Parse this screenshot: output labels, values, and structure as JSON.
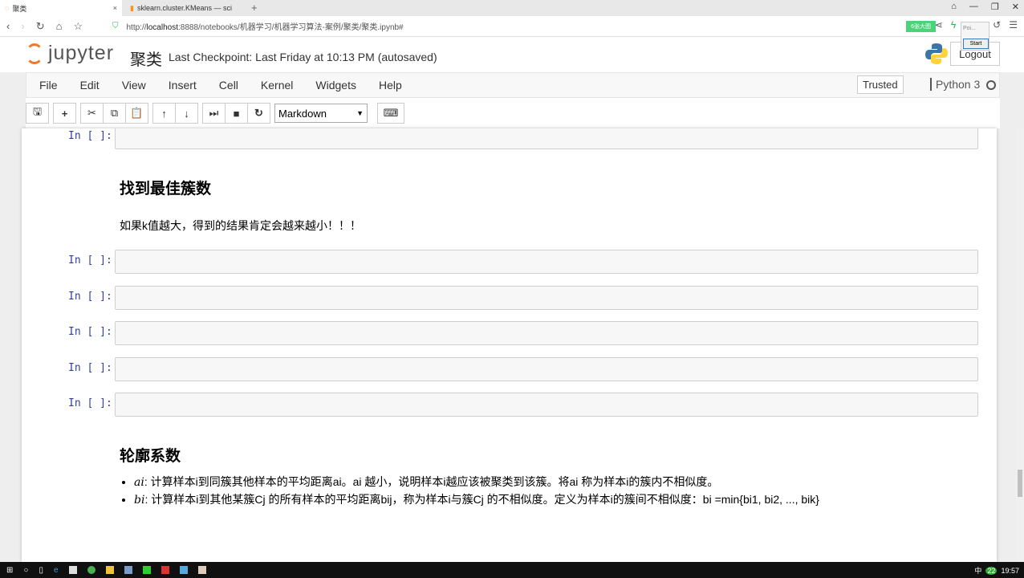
{
  "browser": {
    "tabs": [
      {
        "label": "聚类",
        "close": "×"
      },
      {
        "label": "sklearn.cluster.KMeans — sci"
      }
    ],
    "new_tab": "+",
    "url_prefix": "http://",
    "url_host": "localhost",
    "url_rest": ":8888/notebooks/机器学习/机器学习算法-案例/聚类/聚类.ipynb#",
    "extension_badge": "6张大图",
    "popup_label": "Poi...",
    "popup_start": "Start"
  },
  "header": {
    "logo_text": "jupyter",
    "notebook_title": "聚类",
    "checkpoint": "Last Checkpoint: Last Friday at 10:13 PM (autosaved)",
    "logout": "Logout"
  },
  "menu": {
    "items": [
      "File",
      "Edit",
      "View",
      "Insert",
      "Cell",
      "Kernel",
      "Widgets",
      "Help"
    ],
    "trusted": "Trusted",
    "kernel": "Python 3"
  },
  "toolbar": {
    "cell_type": "Markdown"
  },
  "cells": {
    "prompt": "In [ ]:"
  },
  "section1": {
    "heading": "找到最佳簇数",
    "text": "如果k值越大，得到的结果肯定会越来越小！！！"
  },
  "section2": {
    "heading": "轮廓系数",
    "bullets": [
      {
        "term": "ai",
        "text": ": 计算样本i到同簇其他样本的平均距离ai。ai 越小，说明样本i越应该被聚类到该簇。将ai 称为样本i的簇内不相似度。"
      },
      {
        "term": "bi",
        "text": ": 计算样本i到其他某簇Cj 的所有样本的平均距离bij，称为样本i与簇Cj 的不相似度。定义为样本i的簇间不相似度：bi =min{bi1, bi2, ..., bik}"
      }
    ]
  },
  "taskbar": {
    "time": "19:57",
    "ime": "中",
    "badge": "22"
  }
}
